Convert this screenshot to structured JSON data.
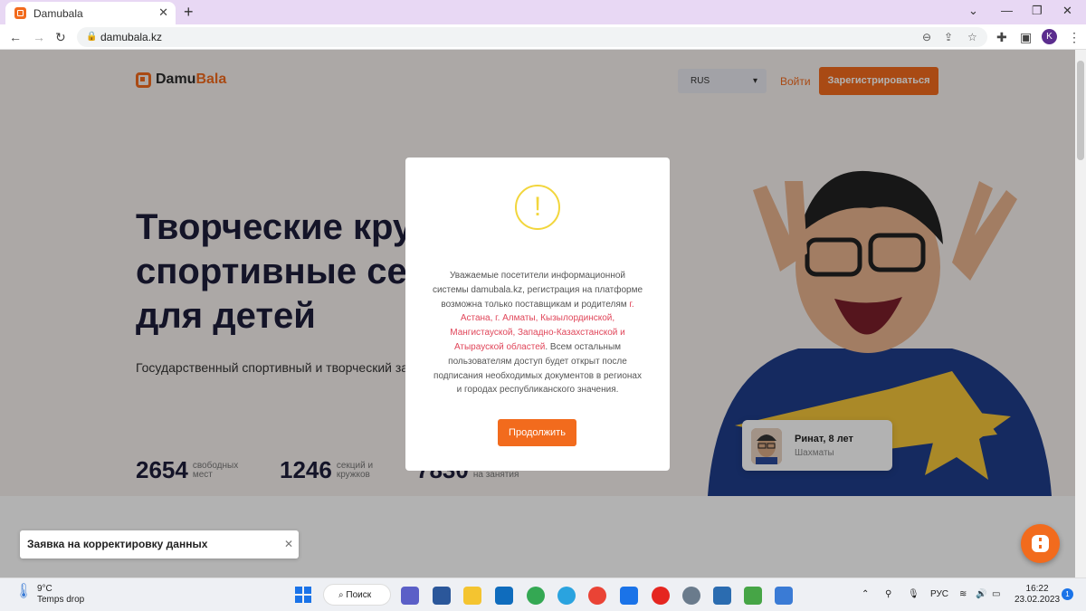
{
  "browser": {
    "tab_title": "Damubala",
    "tab_close": "✕",
    "new_tab": "+",
    "url": "damubala.kz",
    "profile_initial": "K"
  },
  "site": {
    "logo_part1": "Damu",
    "logo_part2": "Bala",
    "lang": "RUS",
    "login": "Войти",
    "register": "Зарегистрироваться",
    "headline": "Творческие кружки и спортивные секции для детей",
    "subtitle": "Государственный спортивный и творческий заказ",
    "stats": [
      {
        "num": "2654",
        "l1": "свободных",
        "l2": "мест"
      },
      {
        "num": "1246",
        "l1": "секций и",
        "l2": "кружков"
      },
      {
        "num": "7830",
        "l1": "",
        "l2": "на занятия"
      }
    ],
    "badge_name": "Ринат, 8 лет",
    "badge_role": "Шахматы",
    "brand_color": "#f26b1d"
  },
  "modal": {
    "icon": "!",
    "text_a": "Уважаемые посетители информационной системы damubala.kz, регистрация на платформе возможна только поставщикам и родителям ",
    "text_hl": "г. Астана, г. Алматы, Кызылординской, Мангистауской, Западно-Казахстанской и Атырауской областей",
    "text_b": ". Всем остальным пользователям доступ будет открыт после подписания необходимых документов в регионах и городах республиканского значения.",
    "button": "Продолжить"
  },
  "toast": {
    "text": "Заявка на корректировку данных",
    "close": "✕"
  },
  "taskbar": {
    "temp": "9°C",
    "weather": "Temps drop",
    "search": "Поиск",
    "lang": "РУС",
    "time": "16:22",
    "date": "23.02.2023",
    "notif": "1"
  }
}
